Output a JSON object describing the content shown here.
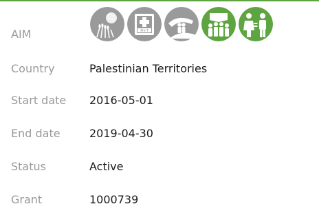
{
  "colors": {
    "accent": "#5ea541",
    "icon_inactive": "#9a9a9a",
    "icon_active": "#5ea541",
    "label_text": "#9a9a9a",
    "value_text": "#1a1a1a"
  },
  "aim": {
    "label": "AIM",
    "icons": [
      {
        "name": "agriculture-icon",
        "state": "inactive"
      },
      {
        "name": "health-kit-icon",
        "state": "inactive"
      },
      {
        "name": "protection-icon",
        "state": "inactive"
      },
      {
        "name": "community-icon",
        "state": "active"
      },
      {
        "name": "gender-equality-icon",
        "state": "active"
      }
    ]
  },
  "fields": [
    {
      "label": "Country",
      "value": "Palestinian Territories"
    },
    {
      "label": "Start date",
      "value": "2016-05-01"
    },
    {
      "label": "End date",
      "value": "2019-04-30"
    },
    {
      "label": "Status",
      "value": "Active"
    },
    {
      "label": "Grant",
      "value": "1000739"
    }
  ]
}
